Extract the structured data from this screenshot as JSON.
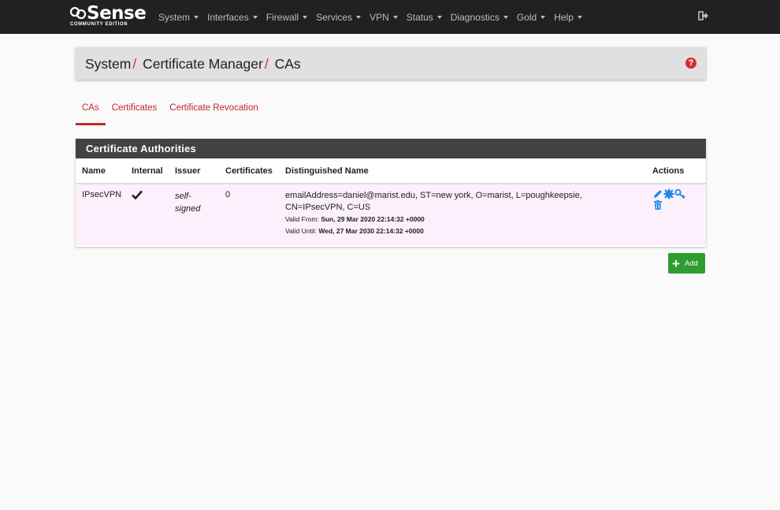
{
  "brand": {
    "logo_text": "pfSense",
    "edition": "COMMUNITY EDITION"
  },
  "nav": {
    "items": [
      "System",
      "Interfaces",
      "Firewall",
      "Services",
      "VPN",
      "Status",
      "Diagnostics",
      "Gold",
      "Help"
    ]
  },
  "breadcrumb": {
    "part1": "System",
    "part2": "Certificate Manager",
    "part3": "CAs",
    "separator": "/"
  },
  "tabs": [
    "CAs",
    "Certificates",
    "Certificate Revocation"
  ],
  "panel": {
    "title": "Certificate Authorities",
    "columns": [
      "Name",
      "Internal",
      "Issuer",
      "Certificates",
      "Distinguished Name",
      "Actions"
    ],
    "rows": [
      {
        "name": "IPsecVPN",
        "internal_icon": "checkmark-icon",
        "issuer_line1": "self-",
        "issuer_line2": "signed",
        "certificates": "0",
        "dn_line1": "emailAddress=daniel@marist.edu, ST=new york, O=marist, L=poughkeepsie,",
        "dn_line2": "CN=IPsecVPN, C=US",
        "valid_from_label": "Valid From: ",
        "valid_from": "Sun, 29 Mar 2020 22:14:32 +0000",
        "valid_until_label": "Valid Until: ",
        "valid_until": "Wed, 27 Mar 2030 22:14:32 +0000"
      }
    ]
  },
  "add_button": {
    "label": "Add"
  },
  "colors": {
    "accent": "#c62828",
    "navbar": "#212121",
    "panel_heading": "#424242",
    "action_blue": "#1e88e5",
    "add_green": "#2e9c2e"
  }
}
